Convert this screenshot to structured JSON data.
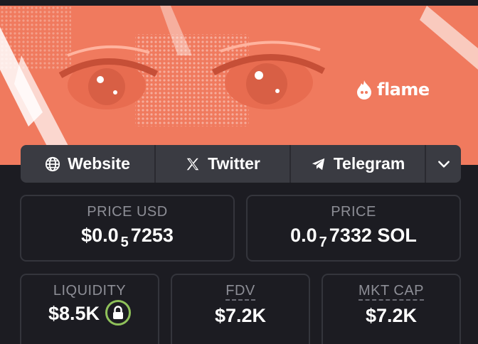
{
  "banner": {
    "brand": "flame",
    "accent": "#f07a5e"
  },
  "links": [
    {
      "label": "Website",
      "icon": "globe-icon"
    },
    {
      "label": "Twitter",
      "icon": "x-logo-icon"
    },
    {
      "label": "Telegram",
      "icon": "telegram-icon"
    }
  ],
  "more_icon": "chevron-down-icon",
  "stats": {
    "price_usd": {
      "label": "PRICE USD",
      "prefix": "$0.0",
      "sub": "5",
      "suffix": "7253"
    },
    "price": {
      "label": "PRICE",
      "prefix": "0.0",
      "sub": "7",
      "suffix": "7332 SOL"
    },
    "liquidity": {
      "label": "LIQUIDITY",
      "value": "$8.5K",
      "lock_color": "#8fc15a"
    },
    "fdv": {
      "label": "FDV",
      "value": "$7.2K"
    },
    "mkt_cap": {
      "label": "MKT CAP",
      "value": "$7.2K"
    }
  }
}
